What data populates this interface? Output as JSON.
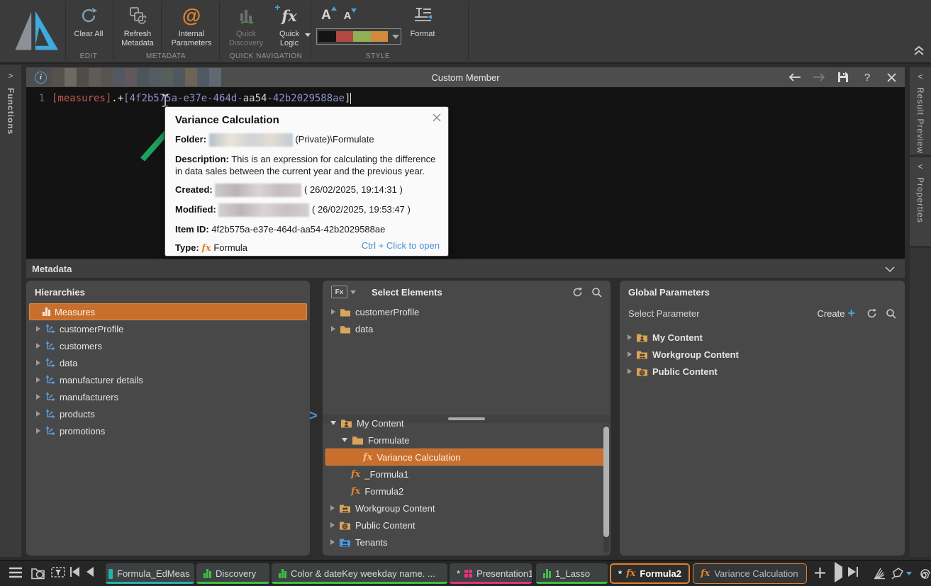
{
  "icons": {
    "at": "@",
    "fx": "fx",
    "help": "?",
    "chevron_right": ">",
    "chevron_left": "<"
  },
  "ribbon": {
    "edit": {
      "group_label": "EDIT",
      "clear_all": "Clear All"
    },
    "metadata": {
      "group_label": "METADATA",
      "refresh_metadata": "Refresh Metadata",
      "internal_parameters": "Internal Parameters"
    },
    "quick_navigation": {
      "group_label": "QUICK NAVIGATION",
      "quick_discovery": "Quick Discovery",
      "quick_logic": "Quick Logic"
    },
    "style": {
      "group_label": "STYLE",
      "format": "Format",
      "palette_colors": [
        "#141414",
        "#b04a42",
        "#8fb054",
        "#d28a3e"
      ]
    }
  },
  "left_rail": {
    "functions": "Functions"
  },
  "right_rail": {
    "result_preview": "Result Preview",
    "properties": "Properties"
  },
  "editor": {
    "title": "Custom Member",
    "line_number": "1",
    "code": {
      "measures": "[measures]",
      "operator": ".+",
      "guid_open": "[4f2b575a-e37e-464d-",
      "guid_mid": "aa54",
      "guid_tail": "-42b2029588ae",
      "bracket_close": "]"
    }
  },
  "tooltip": {
    "title": "Variance Calculation",
    "folder_label": "Folder:",
    "folder_value": "(Private)\\Formulate",
    "description_label": "Description:",
    "description_value": "This is an expression for calculating the difference in data sales between the current year and the previous year.",
    "created_label": "Created:",
    "created_value": "( 26/02/2025, 19:14:31 )",
    "modified_label": "Modified:",
    "modified_value": "( 26/02/2025, 19:53:47 )",
    "item_id_label": "Item ID:",
    "item_id_value": "4f2b575a-e37e-464d-aa54-42b2029588ae",
    "type_label": "Type:",
    "type_fx": "fx",
    "type_value": "Formula",
    "open_hint": "Ctrl + Click to open"
  },
  "metadata_bar": {
    "title": "Metadata"
  },
  "hierarchies": {
    "title": "Hierarchies",
    "items": [
      {
        "label": "Measures"
      },
      {
        "label": "customerProfile"
      },
      {
        "label": "customers"
      },
      {
        "label": "data"
      },
      {
        "label": "manufacturer details"
      },
      {
        "label": "manufacturers"
      },
      {
        "label": "products"
      },
      {
        "label": "promotions"
      }
    ]
  },
  "select_elements": {
    "title": "Select Elements",
    "fx_button": "Fx",
    "folders": [
      {
        "label": "customerProfile"
      },
      {
        "label": "data"
      }
    ],
    "content_tree": [
      {
        "label": "My Content"
      },
      {
        "label": "Formulate"
      },
      {
        "label": "Variance Calculation"
      },
      {
        "label": "_Formula1"
      },
      {
        "label": "Formula2"
      },
      {
        "label": "Workgroup Content"
      },
      {
        "label": "Public Content"
      },
      {
        "label": "Tenants"
      }
    ]
  },
  "global_parameters": {
    "title": "Global Parameters",
    "select_parameter": "Select Parameter",
    "create": "Create",
    "items": [
      {
        "label": "My Content"
      },
      {
        "label": "Workgroup Content"
      },
      {
        "label": "Public Content"
      }
    ]
  },
  "bottom_bar": {
    "tabs": [
      {
        "label": "Formula_EdMeas",
        "color": "#1fb5ad"
      },
      {
        "label": "Discovery",
        "color": "#3fbf44"
      },
      {
        "label": "Color & dateKey weekday name. ...",
        "color": "#3fbf44"
      },
      {
        "label": "Presentation1",
        "color": "#e5327c",
        "dirty": "*"
      },
      {
        "label": "1_Lasso",
        "color": "#3fbf44"
      },
      {
        "label": "Formula2",
        "color": "#e0812f",
        "dirty": "*"
      },
      {
        "label": "Variance Calculation",
        "color": "#e0812f"
      }
    ]
  }
}
